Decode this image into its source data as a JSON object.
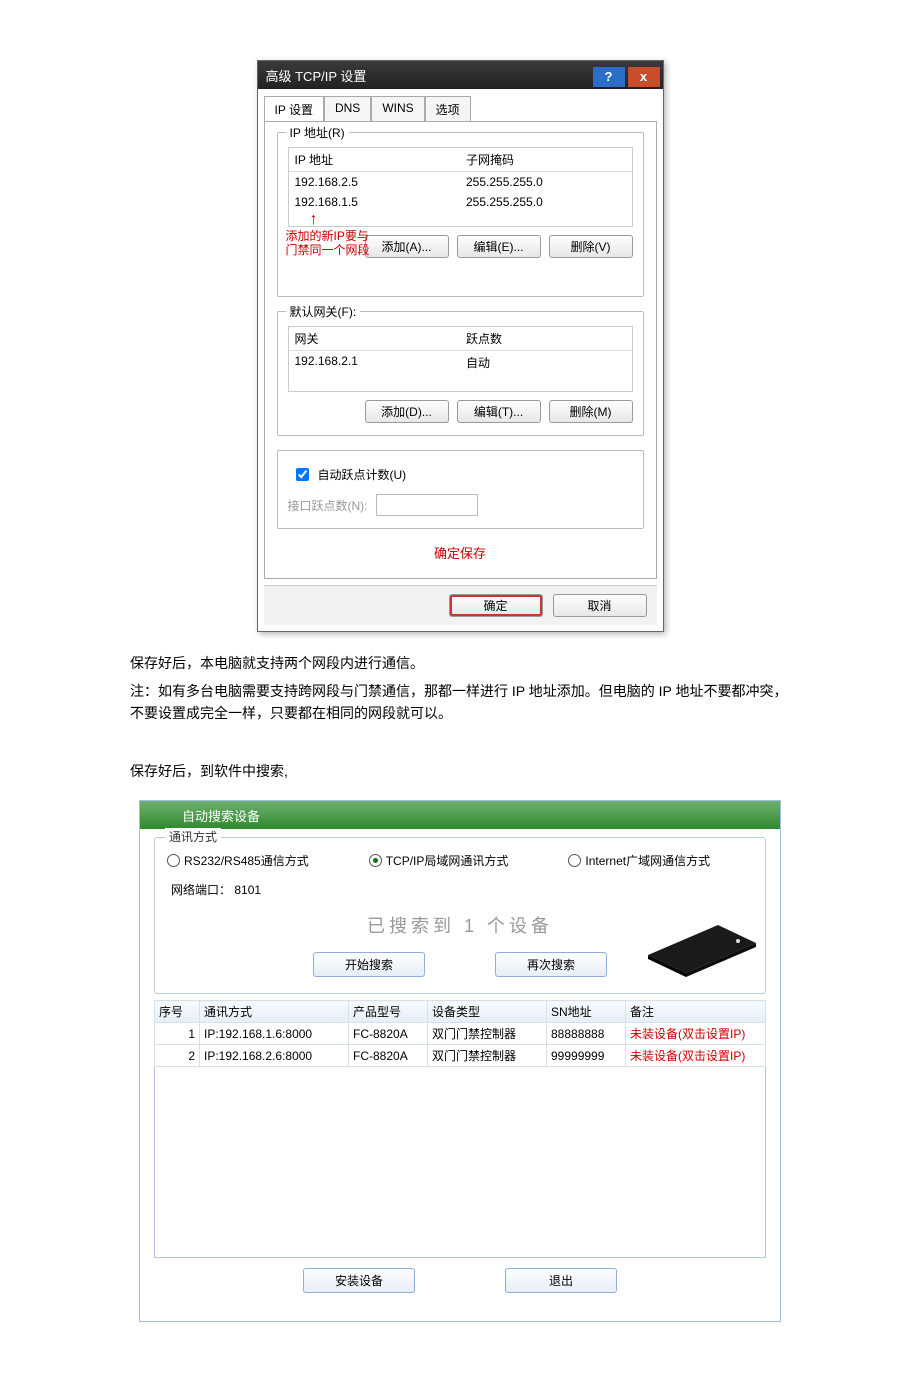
{
  "tcpip": {
    "title": "高级 TCP/IP 设置",
    "tabs": {
      "ip": "IP 设置",
      "dns": "DNS",
      "wins": "WINS",
      "opt": "选项"
    },
    "ip_group_title": "IP 地址(R)",
    "ip_head_addr": "IP 地址",
    "ip_head_mask": "子网掩码",
    "ip_rows": [
      {
        "addr": "192.168.2.5",
        "mask": "255.255.255.0"
      },
      {
        "addr": "192.168.1.5",
        "mask": "255.255.255.0"
      }
    ],
    "annot_new_ip": "添加的新IP要与门禁同一个网段",
    "btn_add_a": "添加(A)...",
    "btn_edit_e": "编辑(E)...",
    "btn_del_v": "删除(V)",
    "gw_group_title": "默认网关(F):",
    "gw_head_gw": "网关",
    "gw_head_hops": "跃点数",
    "gw_rows": [
      {
        "gw": "192.168.2.1",
        "hops": "自动"
      }
    ],
    "btn_add_d": "添加(D)...",
    "btn_edit_t": "编辑(T)...",
    "btn_del_m": "删除(M)",
    "auto_metric": "自动跃点计数(U)",
    "if_metric": "接口跃点数(N):",
    "save_annot": "确定保存",
    "ok": "确定",
    "cancel": "取消"
  },
  "doc": {
    "p1": "保存好后，本电脑就支持两个网段内进行通信。",
    "p2": "注：如有多台电脑需要支持跨网段与门禁通信，那都一样进行 IP 地址添加。但电脑的 IP 地址不要都冲突，不要设置成完全一样，只要都在相同的网段就可以。",
    "p3": "保存好后，到软件中搜索,"
  },
  "search": {
    "title": "自动搜索设备",
    "fs_title": "通讯方式",
    "radio_rs": "RS232/RS485通信方式",
    "radio_tcp": "TCP/IP局域网通讯方式",
    "radio_net": "Internet广域网通信方式",
    "port_label": "网络端口：",
    "port_value": "8101",
    "searched": "已搜索到  1 个设备",
    "btn_start": "开始搜索",
    "btn_again": "再次搜索",
    "cols": {
      "idx": "序号",
      "comm": "通讯方式",
      "model": "产品型号",
      "type": "设备类型",
      "sn": "SN地址",
      "remark": "备注"
    },
    "rows": [
      {
        "idx": "1",
        "comm": "IP:192.168.1.6:8000",
        "model": "FC-8820A",
        "type": "双门门禁控制器",
        "sn": "88888888",
        "remark": "未装设备(双击设置IP)"
      },
      {
        "idx": "2",
        "comm": "IP:192.168.2.6:8000",
        "model": "FC-8820A",
        "type": "双门门禁控制器",
        "sn": "99999999",
        "remark": "未装设备(双击设置IP)"
      }
    ],
    "btn_install": "安装设备",
    "btn_exit": "退出"
  }
}
